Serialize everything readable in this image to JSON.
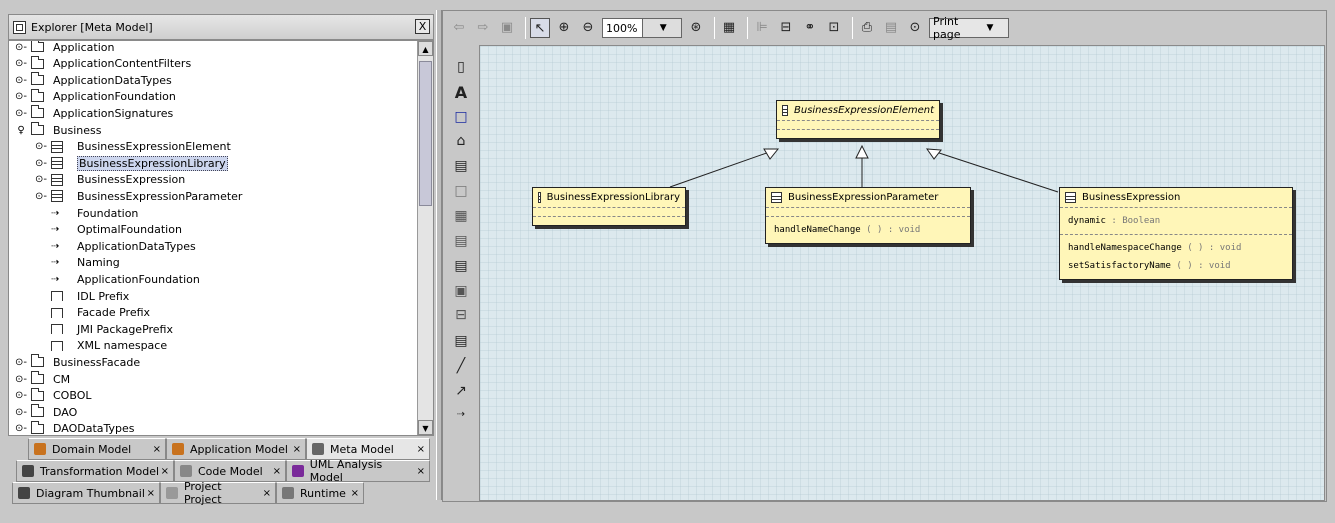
{
  "explorer": {
    "title": "Explorer [Meta Model]",
    "close": "X",
    "tree": [
      {
        "label": "Application",
        "type": "folder",
        "depth": 0,
        "expander": "⊙-"
      },
      {
        "label": "ApplicationContentFilters",
        "type": "folder",
        "depth": 0,
        "expander": "⊙-"
      },
      {
        "label": "ApplicationDataTypes",
        "type": "folder",
        "depth": 0,
        "expander": "⊙-"
      },
      {
        "label": "ApplicationFoundation",
        "type": "folder",
        "depth": 0,
        "expander": "⊙-"
      },
      {
        "label": "ApplicationSignatures",
        "type": "folder",
        "depth": 0,
        "expander": "⊙-"
      },
      {
        "label": "Business",
        "type": "folder",
        "depth": 0,
        "expander": "♀"
      },
      {
        "label": "BusinessExpressionElement",
        "type": "class",
        "depth": 1,
        "expander": "⊙-"
      },
      {
        "label": "BusinessExpressionLibrary",
        "type": "class",
        "depth": 1,
        "expander": "⊙-",
        "selected": true
      },
      {
        "label": "BusinessExpression",
        "type": "class",
        "depth": 1,
        "expander": "⊙-"
      },
      {
        "label": "BusinessExpressionParameter",
        "type": "class",
        "depth": 1,
        "expander": "⊙-"
      },
      {
        "label": "Foundation",
        "type": "link",
        "depth": 1,
        "expander": ""
      },
      {
        "label": "OptimalFoundation",
        "type": "link",
        "depth": 1,
        "expander": ""
      },
      {
        "label": "ApplicationDataTypes",
        "type": "link",
        "depth": 1,
        "expander": ""
      },
      {
        "label": "Naming",
        "type": "link",
        "depth": 1,
        "expander": ""
      },
      {
        "label": "ApplicationFoundation",
        "type": "link",
        "depth": 1,
        "expander": ""
      },
      {
        "label": "IDL Prefix",
        "type": "tag",
        "depth": 1,
        "expander": ""
      },
      {
        "label": "Facade Prefix",
        "type": "tag",
        "depth": 1,
        "expander": ""
      },
      {
        "label": "JMI PackagePrefix",
        "type": "tag",
        "depth": 1,
        "expander": ""
      },
      {
        "label": "XML namespace",
        "type": "tag",
        "depth": 1,
        "expander": ""
      },
      {
        "label": "BusinessFacade",
        "type": "folder",
        "depth": 0,
        "expander": "⊙-"
      },
      {
        "label": "CM",
        "type": "folder",
        "depth": 0,
        "expander": "⊙-"
      },
      {
        "label": "COBOL",
        "type": "folder",
        "depth": 0,
        "expander": "⊙-"
      },
      {
        "label": "DAO",
        "type": "folder",
        "depth": 0,
        "expander": "⊙-"
      },
      {
        "label": "DAODataTypes",
        "type": "folder",
        "depth": 0,
        "expander": "⊙-"
      }
    ]
  },
  "tabs": {
    "row1": [
      {
        "label": "Domain Model",
        "active": false,
        "color": "#c8721e"
      },
      {
        "label": "Application Model",
        "active": false,
        "color": "#c8721e"
      },
      {
        "label": "Meta Model",
        "active": true,
        "color": "#666666"
      }
    ],
    "row2": [
      {
        "label": "Transformation Model",
        "active": false,
        "color": "#444444"
      },
      {
        "label": "Code Model",
        "active": false,
        "color": "#888888"
      },
      {
        "label": "UML Analysis Model",
        "active": false,
        "color": "#7a2a9a"
      }
    ],
    "row3": [
      {
        "label": "Diagram Thumbnail",
        "active": false,
        "color": "#444444"
      },
      {
        "label": "Project Project",
        "active": false,
        "color": "#999999"
      },
      {
        "label": "Runtime",
        "active": false,
        "color": "#777777"
      }
    ],
    "close": "×"
  },
  "toolbar": {
    "zoom": "100%",
    "print": "Print page"
  },
  "diagram": {
    "classes": {
      "element": {
        "name": "BusinessExpressionElement"
      },
      "library": {
        "name": "BusinessExpressionLibrary"
      },
      "parameter": {
        "name": "BusinessExpressionParameter",
        "op_name": "handleNameChange",
        "op_parens": "(    )",
        "op_colon": ":",
        "op_type": "void"
      },
      "expression": {
        "name": "BusinessExpression",
        "attr_name": "dynamic",
        "attr_colon": ":",
        "attr_type": "Boolean",
        "op1_name": "handleNamespaceChange",
        "op1_parens": "(    )",
        "op1_colon": ":",
        "op1_type": "void",
        "op2_name": "setSatisfactoryName",
        "op2_parens": "(    )",
        "op2_colon": ":",
        "op2_type": "void"
      }
    }
  }
}
